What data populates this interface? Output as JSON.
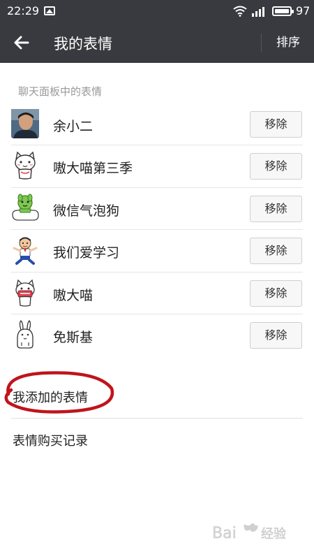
{
  "status_bar": {
    "time": "22:29",
    "battery_level": "97"
  },
  "header": {
    "title": "我的表情",
    "sort_label": "排序"
  },
  "section_label": "聊天面板中的表情",
  "stickers": [
    {
      "name": "余小二",
      "remove_label": "移除",
      "icon": "photo-avatar-icon"
    },
    {
      "name": "嗷大喵第三季",
      "remove_label": "移除",
      "icon": "white-cat-icon"
    },
    {
      "name": "微信气泡狗",
      "remove_label": "移除",
      "icon": "green-bubble-dog-icon"
    },
    {
      "name": "我们爱学习",
      "remove_label": "移除",
      "icon": "student-boy-icon"
    },
    {
      "name": "嗷大喵",
      "remove_label": "移除",
      "icon": "cat-holding-sign-icon"
    },
    {
      "name": "免斯基",
      "remove_label": "移除",
      "icon": "rabbit-icon"
    }
  ],
  "menu": {
    "my_added": "我添加的表情",
    "purchase_history": "表情购买记录"
  },
  "watermark": "Bai 经验",
  "colors": {
    "app_bar": "#393a3f",
    "highlight_circle": "#c0141b",
    "section_label": "#999999"
  }
}
